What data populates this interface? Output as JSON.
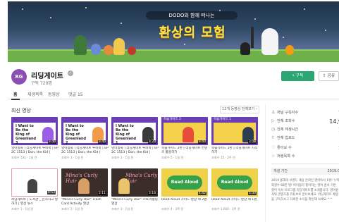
{
  "banner": {
    "subtitle": "DODO와 함께 떠나는",
    "title": "환상의 모험"
  },
  "channel": {
    "avatar_text": "RG",
    "name": "리딩게이트",
    "subscribers": "구독 729명",
    "subscribe_label": "+ 구독",
    "share_label": "공유"
  },
  "tabs": [
    {
      "label": "홈"
    },
    {
      "label": "재생목록"
    },
    {
      "label": "동영상"
    },
    {
      "label": "댓글 15"
    }
  ],
  "section": {
    "title": "최신 영상",
    "play_all": "12개 동영상 전체보기 ›"
  },
  "videos_row1": [
    {
      "thumb_label": "I Want to Be the King of Greenland 3",
      "duration": "9:40",
      "title": "영어동화 | 리딩게이트 루비북 | EP 2C 1513 | Don, the Kid |",
      "meta": "조회수 131 · 1일 전"
    },
    {
      "thumb_label": "I Want to Be the King of Greenland 2",
      "duration": "9:40",
      "title": "영어동화 | 리딩게이트 루비북 | EP 2C 1513 | Don, the Kid |",
      "meta": "조회수 1 · 1일 전"
    },
    {
      "thumb_label": "I Want to Be the King of Greenland 1",
      "duration": "9:20",
      "title": "영어동화 | 리딩게이트 루비북 | EP 2C 1513 | Don, the Kid |",
      "meta": "조회수 1 · 1일 전"
    },
    {
      "thumb_label": "학습가이드 2",
      "duration": "9:40",
      "title": "학습가이드 2탄 | 리딩게이트 컨텐츠 활용하기",
      "meta": "조회수 5 · 1일 전"
    },
    {
      "thumb_label": "학습가이드 1",
      "duration": "3:08",
      "title": "학습가이드 1탄 | 리딩게이트 시작하기",
      "meta": "조회수 15 · 2주 전"
    }
  ],
  "videos_row2": [
    {
      "thumb_label": "",
      "duration": "0:53",
      "title": "리딩게이트 | 도서관 _ 인사하고 말하기 | 영상 뉴스",
      "meta": "조회수 1 · 1일 전"
    },
    {
      "thumb_label": "Mina's Curly Hair",
      "duration": "2:11",
      "title": "\"Mina's Curly Hair\" Flash Card Activity 영상",
      "meta": "조회수 2 · 1일 전"
    },
    {
      "thumb_label": "Mina's Curly Hair",
      "duration": "3:18",
      "title": "\"Mina's Curly Hair\" 스토리텔링 영상",
      "meta": "조회수 3 · 1일 전"
    },
    {
      "thumb_label": "Read Aloud",
      "duration": "4:42",
      "title": "Read Aloud 가이드 영상 제 2편",
      "meta": "조회수 4 · 3주 전"
    },
    {
      "thumb_label": "Read Aloud",
      "duration": "5:30",
      "title": "Read Aloud 가이드 영상 제 1편",
      "meta": "조회수 1,600 · 3주 전"
    }
  ],
  "stats": [
    {
      "icon": "user-icon",
      "label": "채널 구독자수",
      "value": "7"
    },
    {
      "icon": "play-icon",
      "label": "전체 조회수",
      "value": "14,9"
    },
    {
      "icon": "clock-icon",
      "label": "전체 재생시간",
      "value": "1"
    },
    {
      "icon": "upload-icon",
      "label": "전체 업로드",
      "value": ""
    },
    {
      "icon": "heart-icon",
      "label": "좋아요 수",
      "value": "1"
    },
    {
      "icon": "star-icon",
      "label": "재생목록 수",
      "value": ""
    }
  ],
  "joined": {
    "label": "개설 기간",
    "date": "2019.0"
  },
  "description": "2019 올해의 브랜드 대상 온라인 영어독서 1위! 누적 회원수 68만 명! 아이들이 좋아하는 영어 원서 기반 영어 독서 프로그램 리딩게이트를 소개합니다. 영어원서와 콘텐츠를 유튜브로 만나보세요. 리딩게이트 채널을 구독하시고 자세한 소식을 확인해 보세요.^^"
}
